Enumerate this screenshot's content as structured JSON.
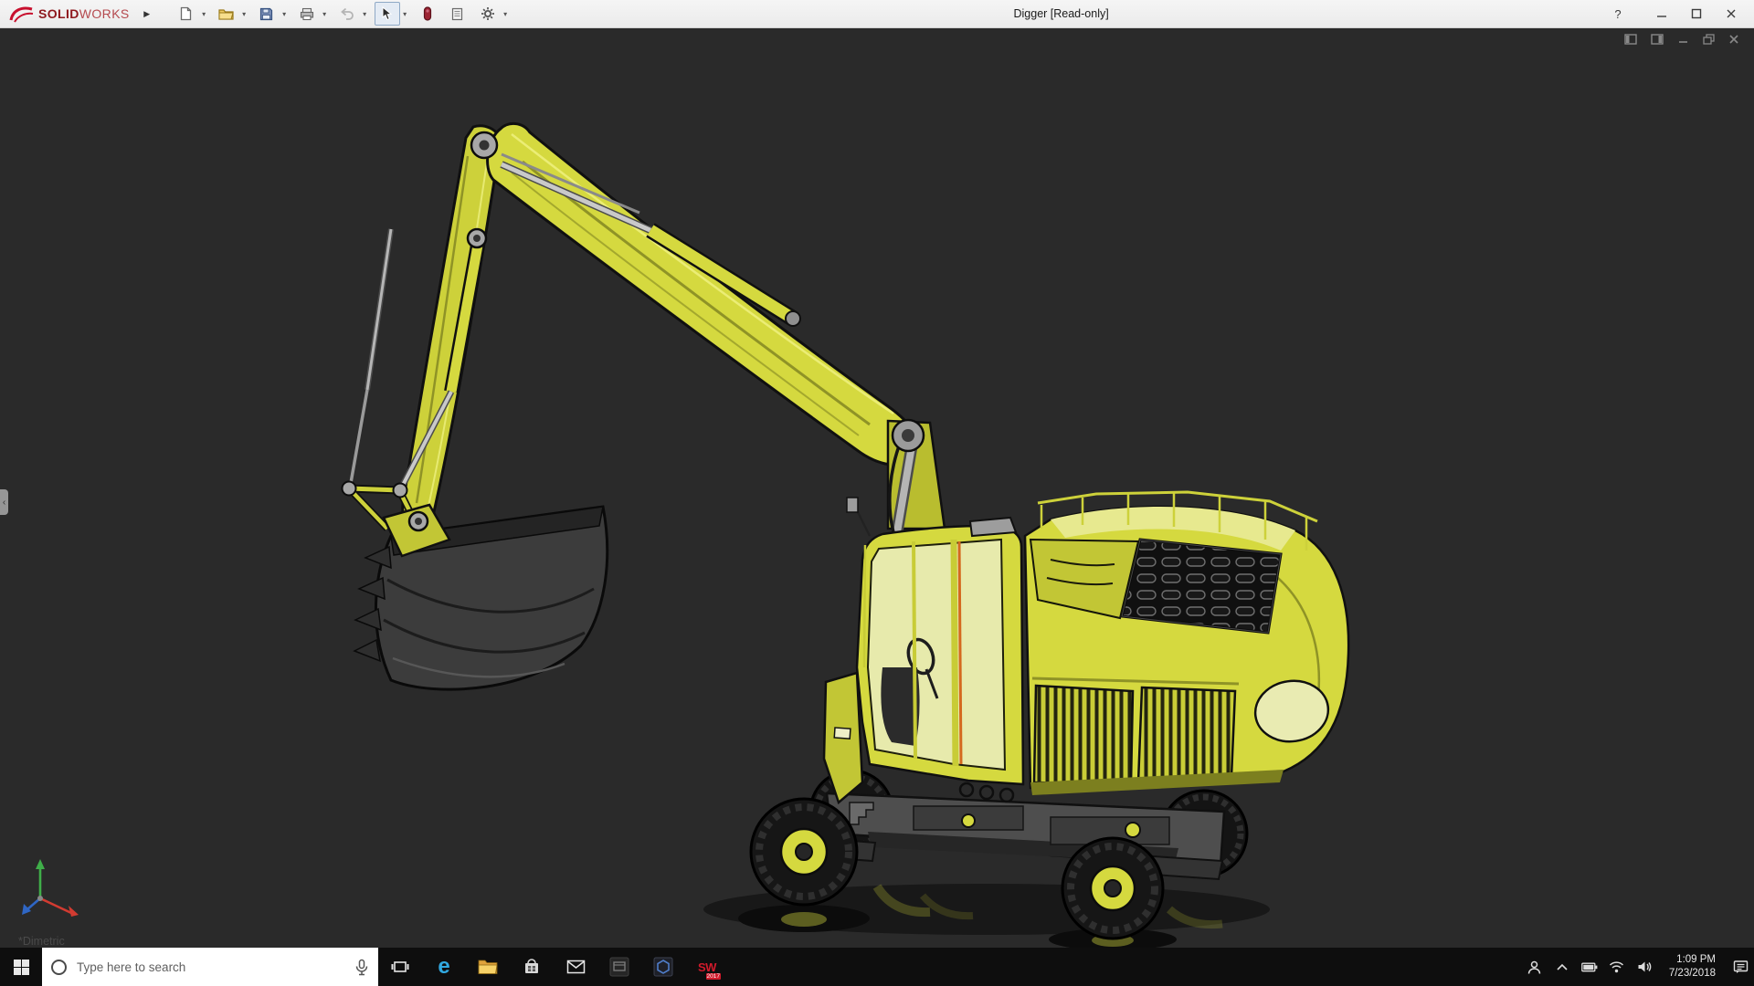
{
  "titlebar": {
    "brand_bold": "SOLID",
    "brand_light": "WORKS",
    "title": "Digger [Read-only]",
    "help_label": "?",
    "toolbar_icons": [
      "new-document",
      "open",
      "save",
      "print",
      "undo",
      "select",
      "rebuild",
      "file-properties",
      "options"
    ],
    "window_controls": [
      "help",
      "minimize",
      "maximize",
      "close"
    ]
  },
  "viewport": {
    "view_label": "*Dimetric",
    "doc_controls": [
      "doc-window-icon-a",
      "doc-window-icon-b",
      "doc-minimize",
      "doc-restore",
      "doc-close"
    ],
    "model": {
      "subject": "yellow wheeled excavator (digger) CAD model",
      "orientation": "Dimetric",
      "triad_axes": [
        "x-red",
        "y-green",
        "z-blue"
      ]
    }
  },
  "taskbar": {
    "search_placeholder": "Type here to search",
    "app_icons": [
      "task-view",
      "edge",
      "file-explorer",
      "store",
      "mail",
      "dark-app-1",
      "dark-app-2",
      "solidworks-2017"
    ],
    "sw_icon": {
      "label": "SW",
      "year": "2017"
    },
    "tray_icons": [
      "people",
      "hidden-icons-chevron",
      "battery",
      "network",
      "volume",
      "action-center"
    ],
    "clock": {
      "time": "1:09 PM",
      "date": "7/23/2018"
    }
  },
  "colors": {
    "model_yellow": "#d5d93f",
    "model_yellow_dark": "#b9bd2f",
    "viewport_bg": "#2a2a2a",
    "titlebar_bg": "#f1f1f1",
    "taskbar_bg": "#0e0e0e",
    "brand_red": "#8e181d",
    "sw_red": "#d11a2b"
  }
}
